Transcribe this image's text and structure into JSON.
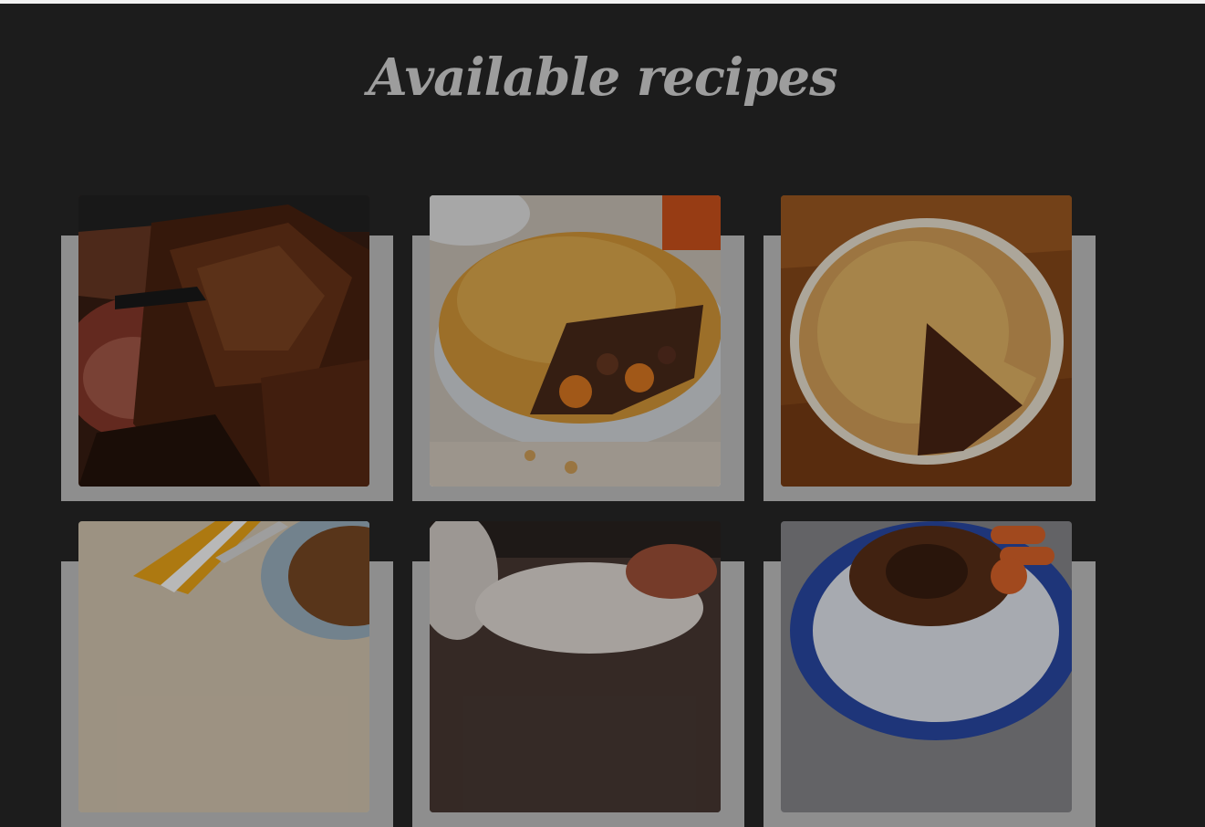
{
  "page": {
    "title": "Available recipes"
  },
  "recipes": [
    {
      "image": "roast-pork-image"
    },
    {
      "image": "steak-pie-image"
    },
    {
      "image": "pot-pie-image"
    },
    {
      "image": "mince-dish-image"
    },
    {
      "image": "stew-pot-image"
    },
    {
      "image": "braised-beef-image"
    }
  ]
}
